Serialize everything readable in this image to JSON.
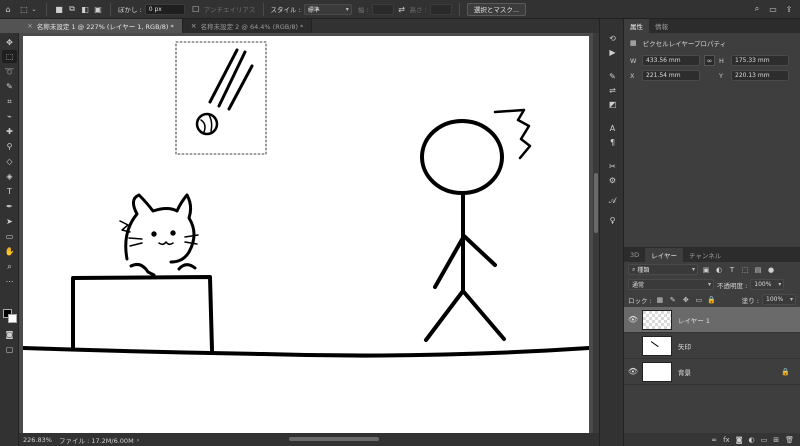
{
  "options_bar": {
    "feather_label": "ぼかし :",
    "feather_value": "0 px",
    "antialias_label": "アンチエイリアス",
    "style_label": "スタイル :",
    "style_value": "標準",
    "width_label": "幅 :",
    "height_label": "高さ :",
    "mask_button": "選択とマスク..."
  },
  "tabs": [
    {
      "label": "名称未設定 1 @ 227% (レイヤー 1, RGB/8) *",
      "close": "×"
    },
    {
      "label": "名称未設定 2 @ 64.4% (RGB/8) *",
      "close": "×"
    }
  ],
  "status": {
    "zoom": "226.83%",
    "file_info": "ファイル : 17.2M/6.00M",
    "arrow": "›"
  },
  "properties": {
    "tab_properties": "属性",
    "tab_info": "情報",
    "title": "ピクセルレイヤープロパティ",
    "w_label": "W",
    "w_value": "433.56 mm",
    "h_label": "H",
    "h_value": "175.33 mm",
    "x_label": "X",
    "x_value": "221.54 mm",
    "y_label": "Y",
    "y_value": "220.13 mm"
  },
  "layers_panel": {
    "tab_3d": "3D",
    "tab_layers": "レイヤー",
    "tab_channels": "チャンネル",
    "filter_label": "種類",
    "blend_mode": "通常",
    "opacity_label": "不透明度 :",
    "opacity_value": "100%",
    "lock_label": "ロック :",
    "fill_label": "塗り :",
    "fill_value": "100%",
    "layers": [
      {
        "name": "レイヤー 1"
      },
      {
        "name": "矢印"
      },
      {
        "name": "背景"
      }
    ]
  },
  "icons": {
    "eye": "👁",
    "lock": "🔒"
  }
}
